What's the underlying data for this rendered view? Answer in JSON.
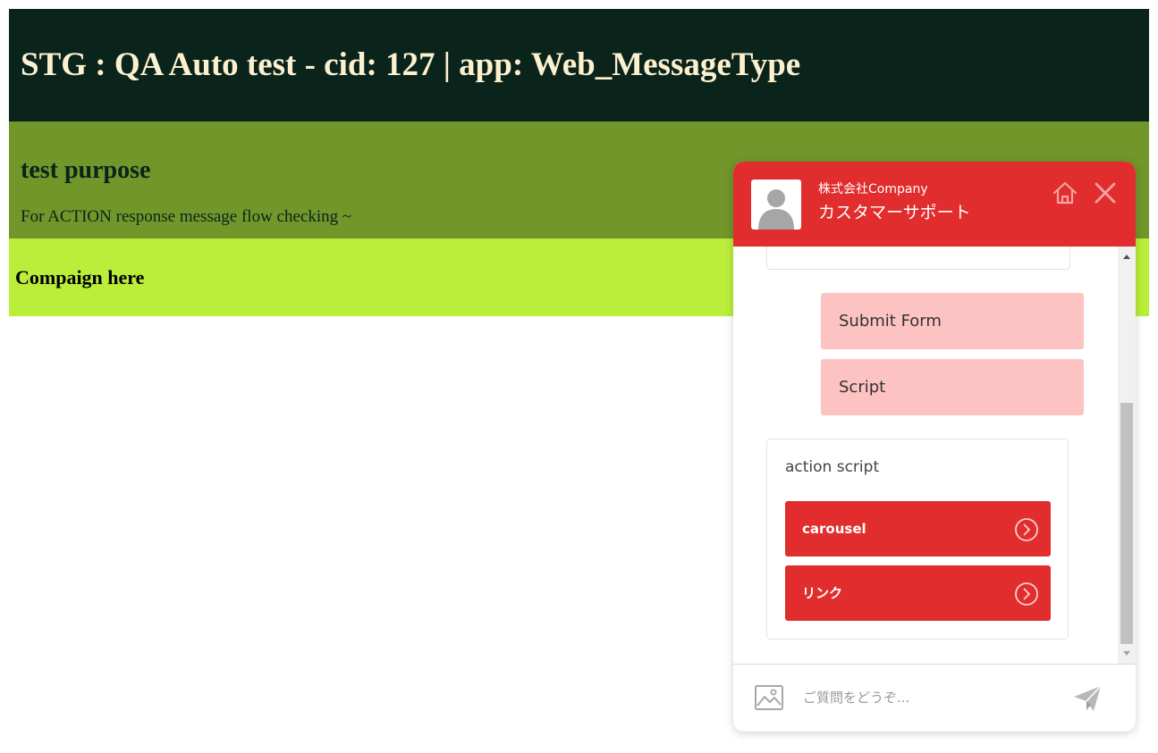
{
  "page": {
    "title": "STG : QA Auto test - cid: 127 | app: Web_MessageType",
    "purpose_heading": "test purpose",
    "purpose_text": "For ACTION response message flow checking ~",
    "campaign_heading": "Compaign here"
  },
  "widget": {
    "company": "株式会社Company",
    "agent_name": "カスタマーサポート",
    "header_icons": [
      "home-icon",
      "close-icon"
    ],
    "replies": [
      "Submit Form",
      "Script"
    ],
    "action_card": {
      "title": "action script",
      "buttons": [
        "carousel",
        "リンク"
      ]
    },
    "input_placeholder": "ご質問をどうぞ...",
    "colors": {
      "accent": "#e12d2d",
      "reply_bg": "#fdc2c2"
    }
  },
  "colors": {
    "banner": "#0a241b",
    "banner_text": "#fdf0cf",
    "purpose": "#71962a",
    "campaign": "#bbee3a"
  }
}
